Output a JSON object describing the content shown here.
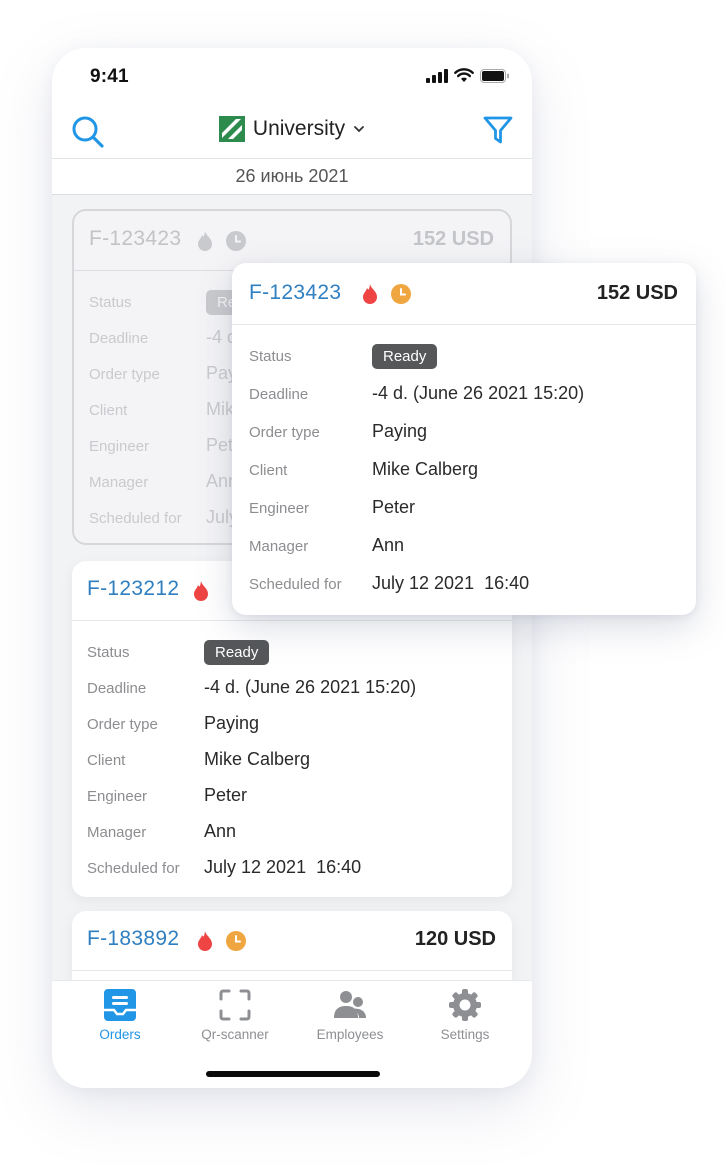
{
  "status_bar": {
    "time": "9:41"
  },
  "header": {
    "title": "University",
    "search_icon": "search-icon",
    "filter_icon": "filter-icon",
    "logo_icon": "striped-green-logo-icon",
    "brand_color": "#2196e6"
  },
  "date_label": "26 июнь 2021",
  "field_labels": {
    "status": "Status",
    "deadline": "Deadline",
    "order_type": "Order type",
    "client": "Client",
    "engineer": "Engineer",
    "manager": "Manager",
    "scheduled": "Scheduled for"
  },
  "orders": [
    {
      "id": "F-123423",
      "amount": "152 USD",
      "urgent": true,
      "clock": true,
      "status": "Ready",
      "deadline": "-4 d. (June 26 2021 15:20)",
      "order_type": "Paying",
      "client": "Mike Calberg",
      "engineer": "Peter",
      "manager": "Ann",
      "scheduled": "July 12 2021  16:40"
    },
    {
      "id": "F-123212",
      "amount": "",
      "urgent": true,
      "clock": false,
      "status": "Ready",
      "deadline": "-4 d. (June 26 2021 15:20)",
      "order_type": "Paying",
      "client": "Mike Calberg",
      "engineer": "Peter",
      "manager": "Ann",
      "scheduled": "July 12 2021  16:40"
    },
    {
      "id": "F-183892",
      "amount": "120 USD",
      "urgent": true,
      "clock": true
    }
  ],
  "popup": {
    "id": "F-123423",
    "amount": "152 USD",
    "status": "Ready",
    "deadline": "-4 d. (June 26 2021 15:20)",
    "order_type": "Paying",
    "client": "Mike Calberg",
    "engineer": "Peter",
    "manager": "Ann",
    "scheduled": "July 12 2021  16:40"
  },
  "tabs": [
    {
      "label": "Orders",
      "icon": "orders-inbox-icon",
      "active": true
    },
    {
      "label": "Qr-scanner",
      "icon": "qr-scan-icon",
      "active": false
    },
    {
      "label": "Employees",
      "icon": "employees-icon",
      "active": false
    },
    {
      "label": "Settings",
      "icon": "gear-icon",
      "active": false
    }
  ],
  "colors": {
    "accent": "#2196e6",
    "order_id": "#2f7fc1",
    "urgent": "#ee4444",
    "clock": "#f0a640",
    "badge": "#555759"
  }
}
